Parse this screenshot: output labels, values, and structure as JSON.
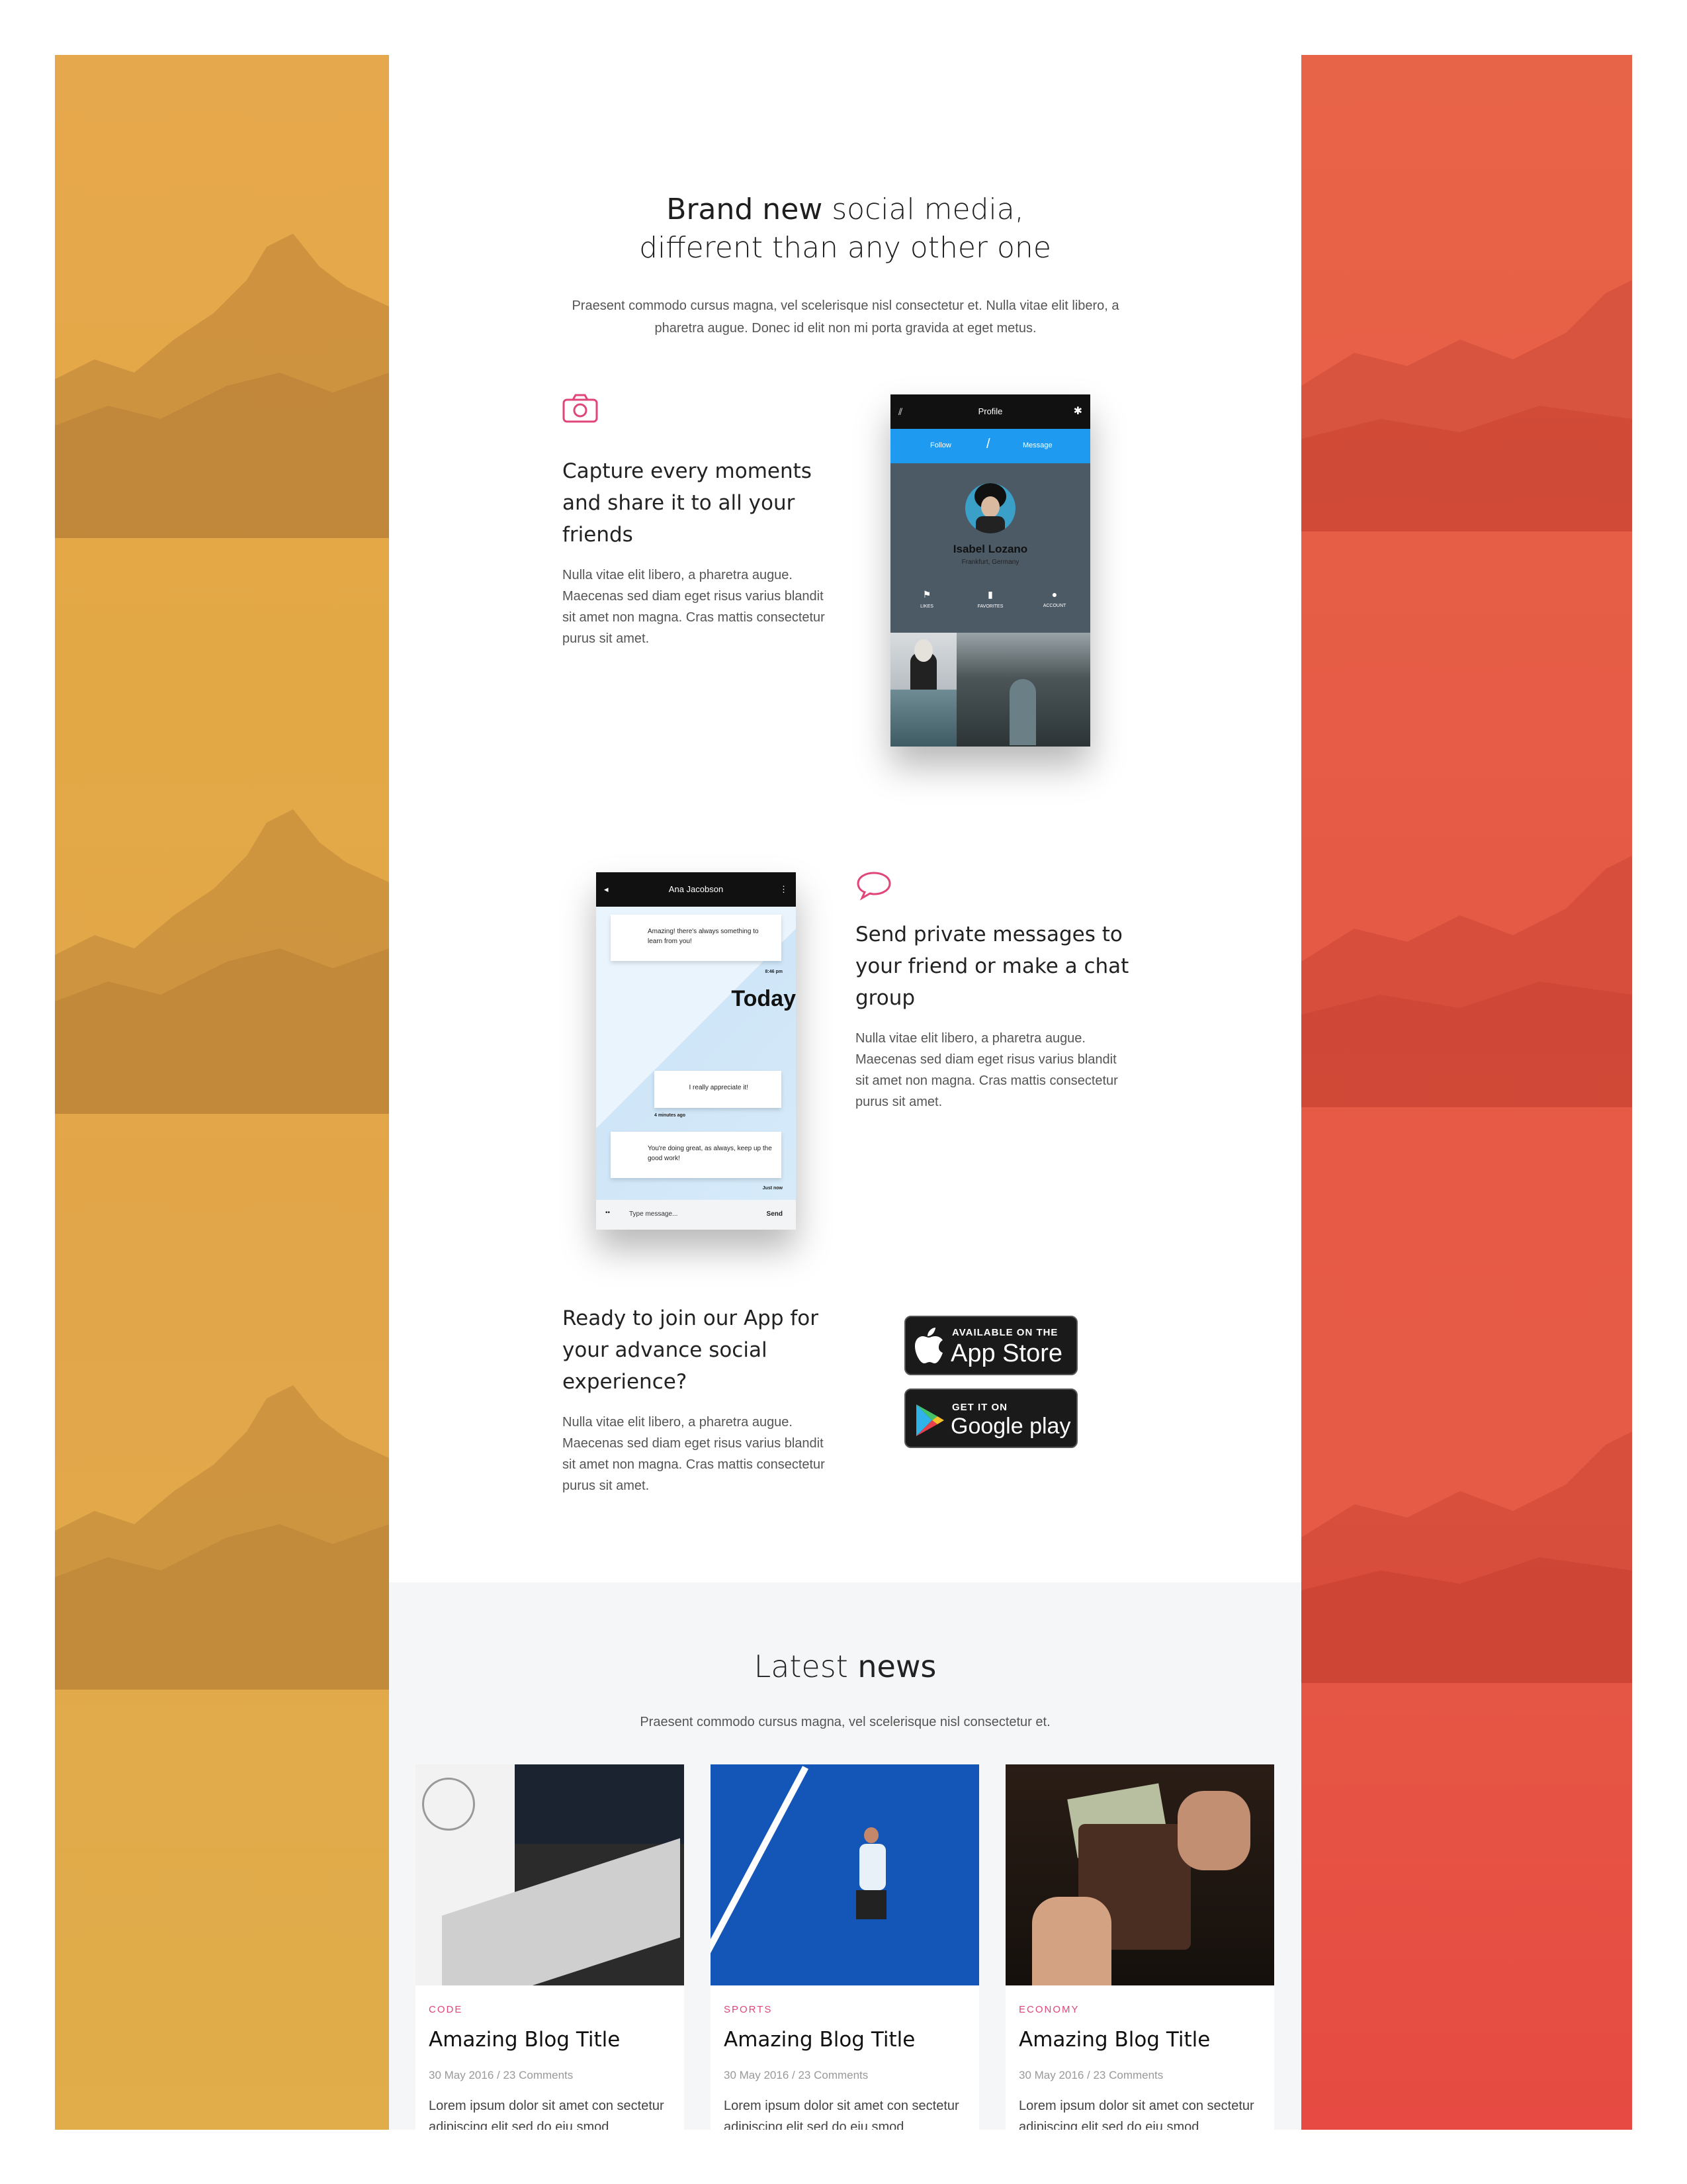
{
  "hero": {
    "title_bold": "Brand new",
    "title_rest": " social media,",
    "title_line2": "different than any other one",
    "subtitle": "Praesent commodo cursus magna, vel scelerisque nisl consectetur et. Nulla vitae elit libero, a pharetra augue. Donec id elit non mi porta gravida at eget metus."
  },
  "features": [
    {
      "icon": "camera-icon",
      "title": "Capture every moments and share it to all your friends",
      "body": "Nulla vitae elit libero, a pharetra augue. Maecenas sed diam eget risus varius blandit sit amet non magna. Cras mattis consectetur purus sit amet."
    },
    {
      "icon": "chat-bubble-icon",
      "title": "Send private messages to your friend or make a chat group",
      "body": "Nulla vitae elit libero, a pharetra augue. Maecenas sed diam eget risus varius blandit sit amet non magna. Cras mattis consectetur purus sit amet."
    },
    {
      "title": "Ready to join our App for your advance social experience?",
      "body": "Nulla vitae elit libero, a pharetra augue. Maecenas sed diam eget risus varius blandit sit amet non magna. Cras mattis consectetur purus sit amet."
    }
  ],
  "profile_phone": {
    "header": "Profile",
    "follow": "Follow",
    "divider": "/",
    "message": "Message",
    "name": "Isabel Lozano",
    "location": "Frankfurt, Germany",
    "tabs": [
      "LIKES",
      "FAVORITES",
      "ACCOUNT"
    ]
  },
  "chat_phone": {
    "header": "Ana Jacobson",
    "msg1": "Amazing! there's always something to learn from you!",
    "time1": "8:46 pm",
    "today": "Today",
    "msg2": "I really appreciate it!",
    "time2": "4 minutes ago",
    "msg3": "You're doing great, as always, keep up the good work!",
    "time3": "Just now",
    "input_placeholder": "Type message...",
    "send": "Send"
  },
  "stores": {
    "apple_small": "AVAILABLE ON THE",
    "apple_big": "App Store",
    "google_small": "GET IT ON",
    "google_big": "Google play"
  },
  "news": {
    "title_light": "Latest ",
    "title_bold": "news",
    "subtitle": "Praesent commodo cursus magna, vel scelerisque nisl consectetur et.",
    "cards": [
      {
        "category": "CODE",
        "title": "Amazing Blog Title",
        "meta": "30 May 2016 / 23 Comments",
        "text": "Lorem ipsum dolor sit amet con sectetur adipiscing elit sed do eiu smod"
      },
      {
        "category": "SPORTS",
        "title": "Amazing Blog Title",
        "meta": "30 May 2016 / 23 Comments",
        "text": "Lorem ipsum dolor sit amet con sectetur adipiscing elit sed do eiu smod"
      },
      {
        "category": "ECONOMY",
        "title": "Amazing Blog Title",
        "meta": "30 May 2016 / 23 Comments",
        "text": "Lorem ipsum dolor sit amet con sectetur adipiscing elit sed do eiu smod"
      }
    ]
  },
  "colors": {
    "accent_pink": "#e0457b",
    "left_panel": "#e4a84a",
    "right_panel": "#e65a45",
    "profile_blue": "#1e9bf0"
  }
}
